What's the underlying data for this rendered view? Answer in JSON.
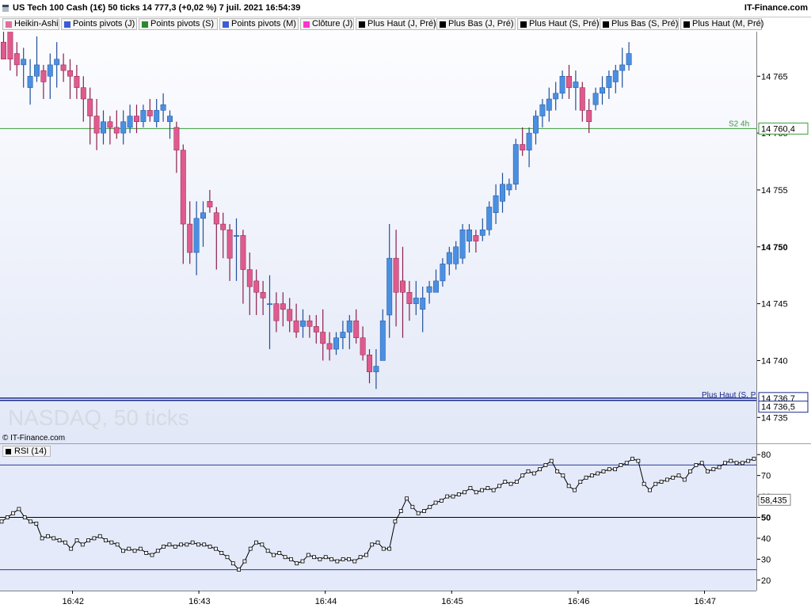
{
  "header": {
    "title": "US Tech 100 Cash (1€) 50 ticks 14 777,3 (+0,02 %) 7 juil. 2021 16:54:39",
    "brand": "IT-Finance.com"
  },
  "legend": [
    {
      "label": "Heikin-Ashi",
      "color": "#e26da0"
    },
    {
      "label": "Points pivots (J)",
      "color": "#3b5bd8"
    },
    {
      "label": "Points pivots (S)",
      "color": "#2a8a2a"
    },
    {
      "label": "Points pivots (M)",
      "color": "#3b5bd8"
    },
    {
      "label": "Clôture (J)",
      "color": "#ff33cc"
    },
    {
      "label": "Plus Haut (J, Pré)",
      "color": "#000000"
    },
    {
      "label": "Plus Bas (J, Pré)",
      "color": "#000000"
    },
    {
      "label": "Plus Haut (S, Pré)",
      "color": "#000000"
    },
    {
      "label": "Plus Bas (S, Pré)",
      "color": "#000000"
    },
    {
      "label": "Plus Haut (M, Pré)",
      "color": "#000000"
    }
  ],
  "watermark": "NASDAQ, 50 ticks",
  "copyright": "© IT-Finance.com",
  "rsi_label": "RSI (14)",
  "colors": {
    "up": "#4a90e2",
    "down": "#e05a8e",
    "up_edge": "#1f4f9a",
    "down_edge": "#8a1f4a",
    "s2_line": "#3a9a3a",
    "level_line": "#1a2a8a"
  },
  "chart_data": [
    {
      "type": "candlestick",
      "title": "US Tech 100 Cash (1€) 50 ticks",
      "xlabel": "",
      "ylabel": "",
      "ylim": [
        14733,
        14768.5
      ],
      "y_ticks": [
        "14 765",
        "14 760",
        "14 755",
        "14 750",
        "14 745",
        "14 740",
        "14 735"
      ],
      "y_tick_values": [
        14765,
        14760,
        14755,
        14750,
        14745,
        14740,
        14735
      ],
      "x_ticks": [
        "16:42",
        "16:43",
        "16:44",
        "16:45",
        "16:46",
        "16:47"
      ],
      "x_tick_index": [
        5,
        24,
        43,
        62,
        81,
        100
      ],
      "levels": [
        {
          "label": "S2 4h",
          "value": 14760.4,
          "box": "14 760,4"
        },
        {
          "label": "Plus Haut (S, Pré)",
          "value": 14736.7,
          "box": "14 736,7"
        },
        {
          "label": "Plus Bas (J, Pré)",
          "value": 14736.5,
          "box": "14 736,5"
        }
      ],
      "candles": [
        [
          14768,
          14769,
          14768,
          14766.5
        ],
        [
          14769,
          14770,
          14765.5,
          14766.5
        ],
        [
          14767,
          14768,
          14765,
          14766
        ],
        [
          14766,
          14767.5,
          14764,
          14766.5
        ],
        [
          14764,
          14766.5,
          14762.5,
          14765
        ],
        [
          14765,
          14768.5,
          14764.5,
          14766
        ],
        [
          14765.5,
          14766,
          14763,
          14764.5
        ],
        [
          14765,
          14767,
          14763,
          14766
        ],
        [
          14766,
          14768,
          14764,
          14766.5
        ],
        [
          14766,
          14767,
          14764.5,
          14765.5
        ],
        [
          14765.5,
          14766.5,
          14763,
          14765
        ],
        [
          14765,
          14766,
          14763,
          14764
        ],
        [
          14764,
          14765,
          14761,
          14763
        ],
        [
          14763,
          14764,
          14759,
          14761.5
        ],
        [
          14761.5,
          14763,
          14758.5,
          14760
        ],
        [
          14760,
          14762,
          14759,
          14761
        ],
        [
          14761,
          14761.5,
          14759,
          14760.5
        ],
        [
          14760.5,
          14762,
          14759.5,
          14760
        ],
        [
          14760,
          14762,
          14759,
          14761
        ],
        [
          14760.5,
          14762.5,
          14760,
          14761.5
        ],
        [
          14761.5,
          14762.5,
          14760,
          14761
        ],
        [
          14761,
          14762.5,
          14760.5,
          14762
        ],
        [
          14762,
          14763,
          14761,
          14761.5
        ],
        [
          14761,
          14763,
          14760.5,
          14762
        ],
        [
          14762,
          14763.5,
          14761,
          14762.5
        ],
        [
          14761,
          14762,
          14759.5,
          14761.5
        ],
        [
          14760.5,
          14761,
          14756.5,
          14758.5
        ],
        [
          14758.5,
          14759,
          14748.5,
          14752
        ],
        [
          14752,
          14754,
          14748.5,
          14749.5
        ],
        [
          14749.5,
          14754,
          14747.5,
          14752.5
        ],
        [
          14752.5,
          14754,
          14750,
          14753
        ],
        [
          14754,
          14755,
          14753,
          14753.5
        ],
        [
          14753,
          14753.5,
          14748,
          14752
        ],
        [
          14752,
          14753,
          14749,
          14751.5
        ],
        [
          14751.5,
          14752,
          14747,
          14749
        ],
        [
          14751,
          14752.5,
          14747,
          14751
        ],
        [
          14751,
          14751.5,
          14745,
          14748
        ],
        [
          14748,
          14749.5,
          14744,
          14746.5
        ],
        [
          14747,
          14748,
          14744,
          14746
        ],
        [
          14746,
          14747,
          14744,
          14745.5
        ],
        [
          14745,
          14747.5,
          14741,
          14745
        ],
        [
          14745,
          14746,
          14742.5,
          14743.5
        ],
        [
          14745,
          14746,
          14743,
          14744.5
        ],
        [
          14744.5,
          14745.5,
          14742.5,
          14743.5
        ],
        [
          14743.5,
          14745,
          14742,
          14742.5
        ],
        [
          14743,
          14744.5,
          14742,
          14743.5
        ],
        [
          14743.5,
          14744,
          14742,
          14743
        ],
        [
          14743,
          14744,
          14741.5,
          14742.5
        ],
        [
          14742.5,
          14744.5,
          14740,
          14741.5
        ],
        [
          14741.5,
          14742.5,
          14740,
          14741
        ],
        [
          14741,
          14742.5,
          14740.5,
          14742
        ],
        [
          14742,
          14743.5,
          14741,
          14742.5
        ],
        [
          14742.5,
          14744,
          14741,
          14743.5
        ],
        [
          14743.5,
          14744.5,
          14741.5,
          14742
        ],
        [
          14742,
          14743,
          14740,
          14740.5
        ],
        [
          14740.5,
          14741,
          14738,
          14739
        ],
        [
          14739,
          14741,
          14737.5,
          14739.5
        ],
        [
          14740,
          14744.5,
          14740,
          14743.5
        ],
        [
          14744,
          14752,
          14742,
          14749
        ],
        [
          14749,
          14751.5,
          14743,
          14746
        ],
        [
          14747,
          14750,
          14742,
          14746
        ],
        [
          14746,
          14747,
          14743.5,
          14745
        ],
        [
          14745,
          14747,
          14744,
          14745.5
        ],
        [
          14744.5,
          14746.5,
          14742.5,
          14745.5
        ],
        [
          14746,
          14747,
          14745,
          14746.5
        ],
        [
          14746,
          14748,
          14746,
          14747
        ],
        [
          14747,
          14749,
          14746.5,
          14748.5
        ],
        [
          14748.5,
          14750,
          14747.5,
          14749.5
        ],
        [
          14748.5,
          14750.5,
          14748,
          14750
        ],
        [
          14749,
          14752,
          14748.5,
          14751.5
        ],
        [
          14750.5,
          14752,
          14749.5,
          14751.5
        ],
        [
          14751,
          14751.5,
          14749.5,
          14750.5
        ],
        [
          14751,
          14752.5,
          14750.5,
          14751.5
        ],
        [
          14751.5,
          14754,
          14751,
          14753.5
        ],
        [
          14753,
          14755.5,
          14752,
          14754.5
        ],
        [
          14754,
          14756.5,
          14753,
          14755.5
        ],
        [
          14755,
          14756,
          14754.5,
          14755.5
        ],
        [
          14755.5,
          14759.5,
          14755,
          14759
        ],
        [
          14759,
          14760.5,
          14758,
          14758.5
        ],
        [
          14758.5,
          14760.5,
          14757,
          14760
        ],
        [
          14760,
          14762,
          14759,
          14761.5
        ],
        [
          14761.5,
          14763,
          14760.5,
          14762.5
        ],
        [
          14762,
          14764,
          14761,
          14763
        ],
        [
          14763,
          14764.5,
          14762,
          14763.5
        ],
        [
          14763.5,
          14765.5,
          14763,
          14765
        ],
        [
          14765,
          14766,
          14763,
          14764
        ],
        [
          14764,
          14765.5,
          14762,
          14764.5
        ],
        [
          14764,
          14764.5,
          14761,
          14762
        ],
        [
          14762,
          14763,
          14760,
          14761
        ],
        [
          14762.5,
          14764,
          14762,
          14763.5
        ],
        [
          14763.5,
          14765,
          14762.5,
          14764
        ],
        [
          14764,
          14765.5,
          14763,
          14765
        ],
        [
          14764.5,
          14766,
          14763.5,
          14765.5
        ],
        [
          14765.5,
          14767.5,
          14764,
          14766
        ],
        [
          14766,
          14768,
          14765.5,
          14767
        ]
      ]
    },
    {
      "type": "line",
      "title": "RSI (14)",
      "xlabel": "",
      "ylabel": "",
      "ylim": [
        15,
        85
      ],
      "y_ticks": [
        "80",
        "70",
        "60",
        "50",
        "40",
        "30",
        "20"
      ],
      "y_tick_values": [
        80,
        70,
        60,
        50,
        40,
        30,
        20
      ],
      "current_value_label": "58,435",
      "current_value": 58.4,
      "bands": [
        75,
        50,
        25
      ],
      "values": [
        48,
        50,
        52,
        54,
        50,
        48,
        47,
        40,
        41,
        40,
        39,
        38,
        35,
        39,
        37,
        39,
        40,
        41,
        39,
        38,
        37,
        34,
        35,
        34,
        35,
        33,
        32,
        34,
        36,
        37,
        36,
        37,
        37,
        38,
        37,
        37,
        36,
        35,
        33,
        31,
        28,
        25,
        29,
        35,
        38,
        37,
        34,
        32,
        33,
        31,
        30,
        28,
        29,
        32,
        31,
        30,
        31,
        30,
        29,
        30,
        30,
        29,
        31,
        32,
        37,
        38,
        35,
        35,
        48,
        53,
        59,
        55,
        52,
        53,
        55,
        57,
        58,
        60,
        60,
        61,
        62,
        64,
        62,
        63,
        64,
        63,
        65,
        67,
        66,
        67,
        70,
        72,
        71,
        73,
        75,
        77,
        72,
        70,
        65,
        63,
        67,
        69,
        70,
        71,
        72,
        73,
        73,
        75,
        76,
        78,
        77,
        66,
        63,
        66,
        67,
        68,
        69,
        70,
        68,
        72,
        75,
        76,
        72,
        73,
        74,
        76,
        77,
        76,
        76,
        77,
        78
      ]
    }
  ]
}
